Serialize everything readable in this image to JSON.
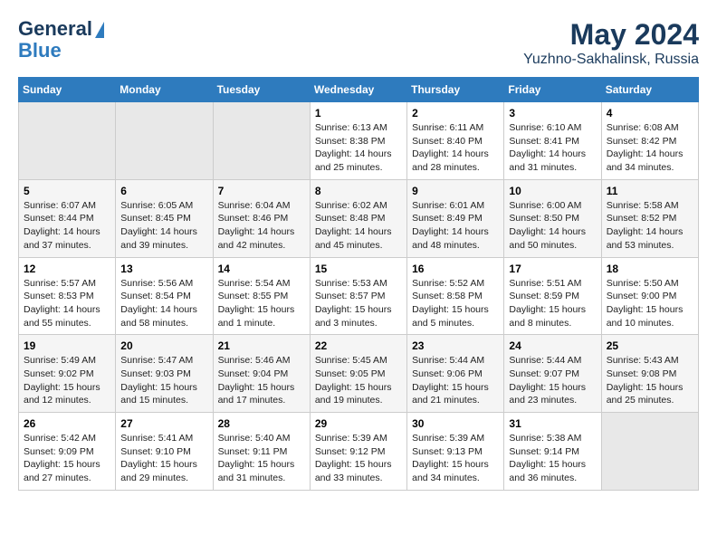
{
  "logo": {
    "line1": "General",
    "line2": "Blue"
  },
  "title": "May 2024",
  "subtitle": "Yuzhno-Sakhalinsk, Russia",
  "days_of_week": [
    "Sunday",
    "Monday",
    "Tuesday",
    "Wednesday",
    "Thursday",
    "Friday",
    "Saturday"
  ],
  "weeks": [
    [
      {
        "day": "",
        "info": ""
      },
      {
        "day": "",
        "info": ""
      },
      {
        "day": "",
        "info": ""
      },
      {
        "day": "1",
        "info": "Sunrise: 6:13 AM\nSunset: 8:38 PM\nDaylight: 14 hours\nand 25 minutes."
      },
      {
        "day": "2",
        "info": "Sunrise: 6:11 AM\nSunset: 8:40 PM\nDaylight: 14 hours\nand 28 minutes."
      },
      {
        "day": "3",
        "info": "Sunrise: 6:10 AM\nSunset: 8:41 PM\nDaylight: 14 hours\nand 31 minutes."
      },
      {
        "day": "4",
        "info": "Sunrise: 6:08 AM\nSunset: 8:42 PM\nDaylight: 14 hours\nand 34 minutes."
      }
    ],
    [
      {
        "day": "5",
        "info": "Sunrise: 6:07 AM\nSunset: 8:44 PM\nDaylight: 14 hours\nand 37 minutes."
      },
      {
        "day": "6",
        "info": "Sunrise: 6:05 AM\nSunset: 8:45 PM\nDaylight: 14 hours\nand 39 minutes."
      },
      {
        "day": "7",
        "info": "Sunrise: 6:04 AM\nSunset: 8:46 PM\nDaylight: 14 hours\nand 42 minutes."
      },
      {
        "day": "8",
        "info": "Sunrise: 6:02 AM\nSunset: 8:48 PM\nDaylight: 14 hours\nand 45 minutes."
      },
      {
        "day": "9",
        "info": "Sunrise: 6:01 AM\nSunset: 8:49 PM\nDaylight: 14 hours\nand 48 minutes."
      },
      {
        "day": "10",
        "info": "Sunrise: 6:00 AM\nSunset: 8:50 PM\nDaylight: 14 hours\nand 50 minutes."
      },
      {
        "day": "11",
        "info": "Sunrise: 5:58 AM\nSunset: 8:52 PM\nDaylight: 14 hours\nand 53 minutes."
      }
    ],
    [
      {
        "day": "12",
        "info": "Sunrise: 5:57 AM\nSunset: 8:53 PM\nDaylight: 14 hours\nand 55 minutes."
      },
      {
        "day": "13",
        "info": "Sunrise: 5:56 AM\nSunset: 8:54 PM\nDaylight: 14 hours\nand 58 minutes."
      },
      {
        "day": "14",
        "info": "Sunrise: 5:54 AM\nSunset: 8:55 PM\nDaylight: 15 hours\nand 1 minute."
      },
      {
        "day": "15",
        "info": "Sunrise: 5:53 AM\nSunset: 8:57 PM\nDaylight: 15 hours\nand 3 minutes."
      },
      {
        "day": "16",
        "info": "Sunrise: 5:52 AM\nSunset: 8:58 PM\nDaylight: 15 hours\nand 5 minutes."
      },
      {
        "day": "17",
        "info": "Sunrise: 5:51 AM\nSunset: 8:59 PM\nDaylight: 15 hours\nand 8 minutes."
      },
      {
        "day": "18",
        "info": "Sunrise: 5:50 AM\nSunset: 9:00 PM\nDaylight: 15 hours\nand 10 minutes."
      }
    ],
    [
      {
        "day": "19",
        "info": "Sunrise: 5:49 AM\nSunset: 9:02 PM\nDaylight: 15 hours\nand 12 minutes."
      },
      {
        "day": "20",
        "info": "Sunrise: 5:47 AM\nSunset: 9:03 PM\nDaylight: 15 hours\nand 15 minutes."
      },
      {
        "day": "21",
        "info": "Sunrise: 5:46 AM\nSunset: 9:04 PM\nDaylight: 15 hours\nand 17 minutes."
      },
      {
        "day": "22",
        "info": "Sunrise: 5:45 AM\nSunset: 9:05 PM\nDaylight: 15 hours\nand 19 minutes."
      },
      {
        "day": "23",
        "info": "Sunrise: 5:44 AM\nSunset: 9:06 PM\nDaylight: 15 hours\nand 21 minutes."
      },
      {
        "day": "24",
        "info": "Sunrise: 5:44 AM\nSunset: 9:07 PM\nDaylight: 15 hours\nand 23 minutes."
      },
      {
        "day": "25",
        "info": "Sunrise: 5:43 AM\nSunset: 9:08 PM\nDaylight: 15 hours\nand 25 minutes."
      }
    ],
    [
      {
        "day": "26",
        "info": "Sunrise: 5:42 AM\nSunset: 9:09 PM\nDaylight: 15 hours\nand 27 minutes."
      },
      {
        "day": "27",
        "info": "Sunrise: 5:41 AM\nSunset: 9:10 PM\nDaylight: 15 hours\nand 29 minutes."
      },
      {
        "day": "28",
        "info": "Sunrise: 5:40 AM\nSunset: 9:11 PM\nDaylight: 15 hours\nand 31 minutes."
      },
      {
        "day": "29",
        "info": "Sunrise: 5:39 AM\nSunset: 9:12 PM\nDaylight: 15 hours\nand 33 minutes."
      },
      {
        "day": "30",
        "info": "Sunrise: 5:39 AM\nSunset: 9:13 PM\nDaylight: 15 hours\nand 34 minutes."
      },
      {
        "day": "31",
        "info": "Sunrise: 5:38 AM\nSunset: 9:14 PM\nDaylight: 15 hours\nand 36 minutes."
      },
      {
        "day": "",
        "info": ""
      }
    ]
  ]
}
